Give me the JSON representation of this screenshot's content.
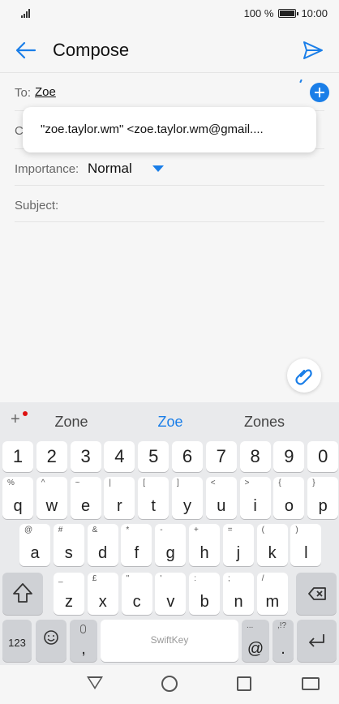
{
  "status_bar": {
    "battery_percent": "100 %",
    "time": "10:00"
  },
  "header": {
    "title": "Compose"
  },
  "form": {
    "to_label": "To:",
    "to_value": "Zoe",
    "cc_label": "C",
    "suggestion": "\"zoe.taylor.wm\" <zoe.taylor.wm@gmail....",
    "importance_label": "Importance:",
    "importance_value": "Normal",
    "subject_label": "Subject:"
  },
  "keyboard": {
    "suggestions": [
      "Zone",
      "Zoe",
      "Zones"
    ],
    "brand": "SwiftKey",
    "row1": [
      [
        "1",
        ""
      ],
      [
        "2",
        ""
      ],
      [
        "3",
        ""
      ],
      [
        "4",
        ""
      ],
      [
        "5",
        ""
      ],
      [
        "6",
        ""
      ],
      [
        "7",
        ""
      ],
      [
        "8",
        ""
      ],
      [
        "9",
        ""
      ],
      [
        "0",
        ""
      ]
    ],
    "row2": [
      [
        "q",
        "%"
      ],
      [
        "w",
        "^"
      ],
      [
        "e",
        "~"
      ],
      [
        "r",
        "|"
      ],
      [
        "t",
        "["
      ],
      [
        "y",
        "]"
      ],
      [
        "u",
        "<"
      ],
      [
        "i",
        ">"
      ],
      [
        "o",
        "{"
      ],
      [
        "p",
        "}"
      ]
    ],
    "row3": [
      [
        "a",
        "@"
      ],
      [
        "s",
        "#"
      ],
      [
        "d",
        "&"
      ],
      [
        "f",
        "*"
      ],
      [
        "g",
        "-"
      ],
      [
        "h",
        "+"
      ],
      [
        "j",
        "="
      ],
      [
        "k",
        "("
      ],
      [
        "l",
        ")"
      ]
    ],
    "row4": [
      [
        "z",
        "_"
      ],
      [
        "x",
        "£"
      ],
      [
        "c",
        "\""
      ],
      [
        "v",
        "'"
      ],
      [
        "b",
        ":"
      ],
      [
        "n",
        ";"
      ],
      [
        "m",
        "/"
      ]
    ],
    "sym_label": "123",
    "comma": ",",
    "at": "@",
    "period": ".",
    "period_sub": ",!?"
  }
}
